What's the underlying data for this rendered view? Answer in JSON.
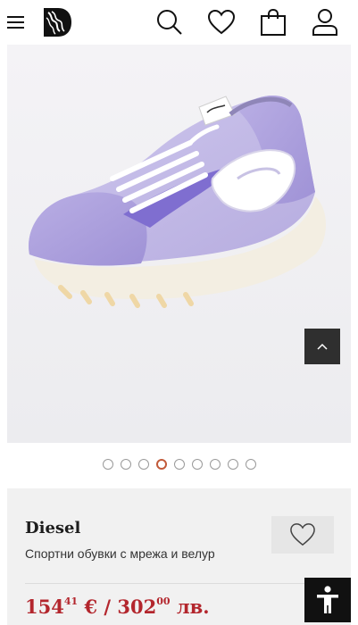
{
  "header": {
    "menu_icon": "hamburger-menu-icon",
    "logo": "brand-logo",
    "search_icon": "search-icon",
    "wishlist_icon": "heart-icon",
    "bag_icon": "shopping-bag-icon",
    "account_icon": "user-icon"
  },
  "gallery": {
    "image": "purple-diesel-sneaker",
    "scroll_top_icon": "chevron-up-icon",
    "dots_total": 9,
    "active_index": 4
  },
  "product": {
    "brand": "Diesel",
    "description": "Спортни обувки с мрежа и велур",
    "price_eur_main": "154",
    "price_eur_cents": "41",
    "price_eur_symbol": "€ /",
    "price_bgn_main": "302",
    "price_bgn_cents": "00",
    "price_bgn_currency": "лв.",
    "favorite_icon": "heart-outline-icon"
  },
  "accessibility": {
    "icon": "accessibility-person-icon"
  },
  "colors": {
    "price": "#b3262d",
    "active_dot": "#c25a3a"
  }
}
